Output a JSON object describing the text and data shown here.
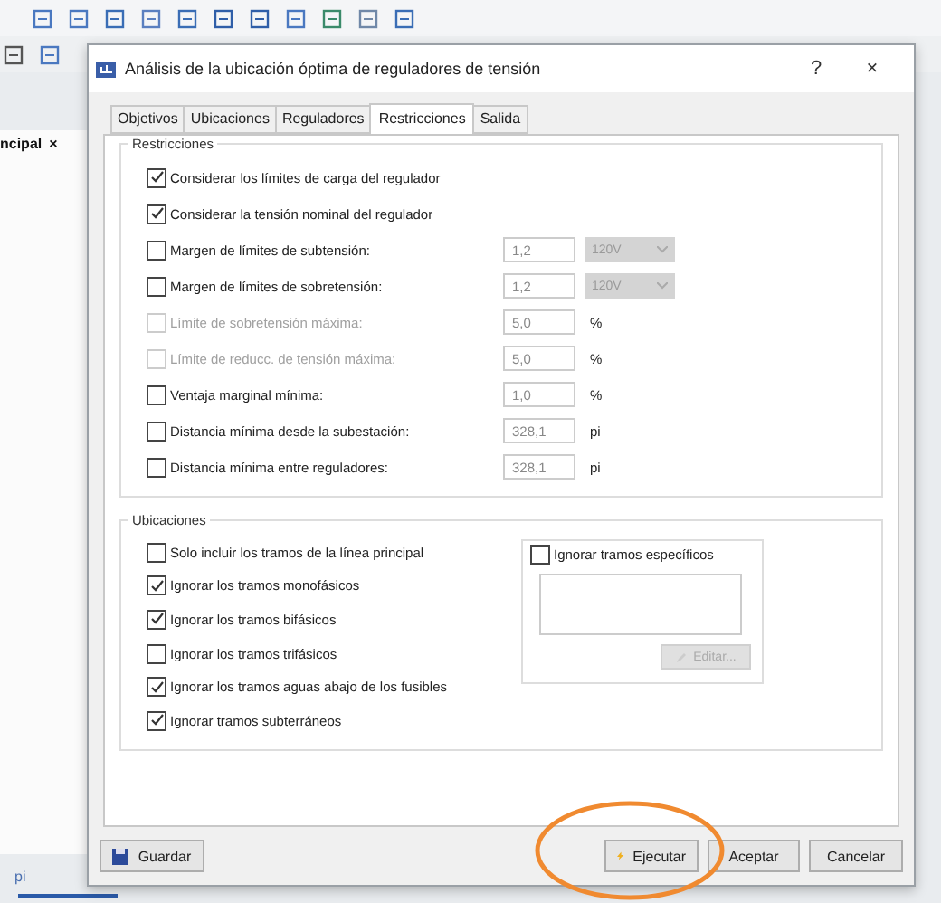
{
  "app": {
    "panel_tab": "ncipal",
    "panel_close": "×",
    "status_text": "pi"
  },
  "dialog": {
    "title": "Análisis de la ubicación óptima de reguladores de tensión",
    "help": "?",
    "close": "×"
  },
  "tabs": [
    {
      "label": "Objetivos",
      "selected": false
    },
    {
      "label": "Ubicaciones",
      "selected": false
    },
    {
      "label": "Reguladores",
      "selected": false
    },
    {
      "label": "Restricciones",
      "selected": true
    },
    {
      "label": "Salida",
      "selected": false
    }
  ],
  "restricciones": {
    "title": "Restricciones",
    "rows": [
      {
        "kind": "check",
        "label": "Considerar los límites de carga del regulador",
        "checked": true,
        "disabled": false
      },
      {
        "kind": "check",
        "label": "Considerar la tensión nominal del regulador",
        "checked": true,
        "disabled": false
      },
      {
        "kind": "select",
        "label": "Margen de límites de subtensión:",
        "checked": false,
        "disabled": false,
        "value": "1,2",
        "select": "120V"
      },
      {
        "kind": "select",
        "label": "Margen de límites de sobretensión:",
        "checked": false,
        "disabled": false,
        "value": "1,2",
        "select": "120V"
      },
      {
        "kind": "unit",
        "label": "Límite de sobretensión máxima:",
        "checked": false,
        "disabled": true,
        "value": "5,0",
        "unit": "%"
      },
      {
        "kind": "unit",
        "label": "Límite de reducc. de tensión máxima:",
        "checked": false,
        "disabled": true,
        "value": "5,0",
        "unit": "%"
      },
      {
        "kind": "unit",
        "label": "Ventaja marginal mínima:",
        "checked": false,
        "disabled": false,
        "value": "1,0",
        "unit": "%"
      },
      {
        "kind": "unit",
        "label": "Distancia mínima desde la subestación:",
        "checked": false,
        "disabled": false,
        "value": "328,1",
        "unit": "pi"
      },
      {
        "kind": "unit",
        "label": "Distancia mínima entre reguladores:",
        "checked": false,
        "disabled": false,
        "value": "328,1",
        "unit": "pi"
      }
    ]
  },
  "ubicaciones": {
    "title": "Ubicaciones",
    "rows": [
      {
        "label": "Solo incluir los tramos de la línea principal",
        "checked": false
      },
      {
        "label": "Ignorar los tramos monofásicos",
        "checked": true
      },
      {
        "label": "Ignorar los tramos bifásicos",
        "checked": true
      },
      {
        "label": "Ignorar los tramos trifásicos",
        "checked": false
      },
      {
        "label": "Ignorar los tramos aguas abajo de los fusibles",
        "checked": true
      },
      {
        "label": "Ignorar tramos subterráneos",
        "checked": true
      }
    ],
    "specific": {
      "label": "Ignorar tramos específicos",
      "checked": false
    },
    "edit_button": "Editar..."
  },
  "buttons": {
    "save": "Guardar",
    "run": "Ejecutar",
    "ok": "Aceptar",
    "cancel": "Cancelar"
  }
}
